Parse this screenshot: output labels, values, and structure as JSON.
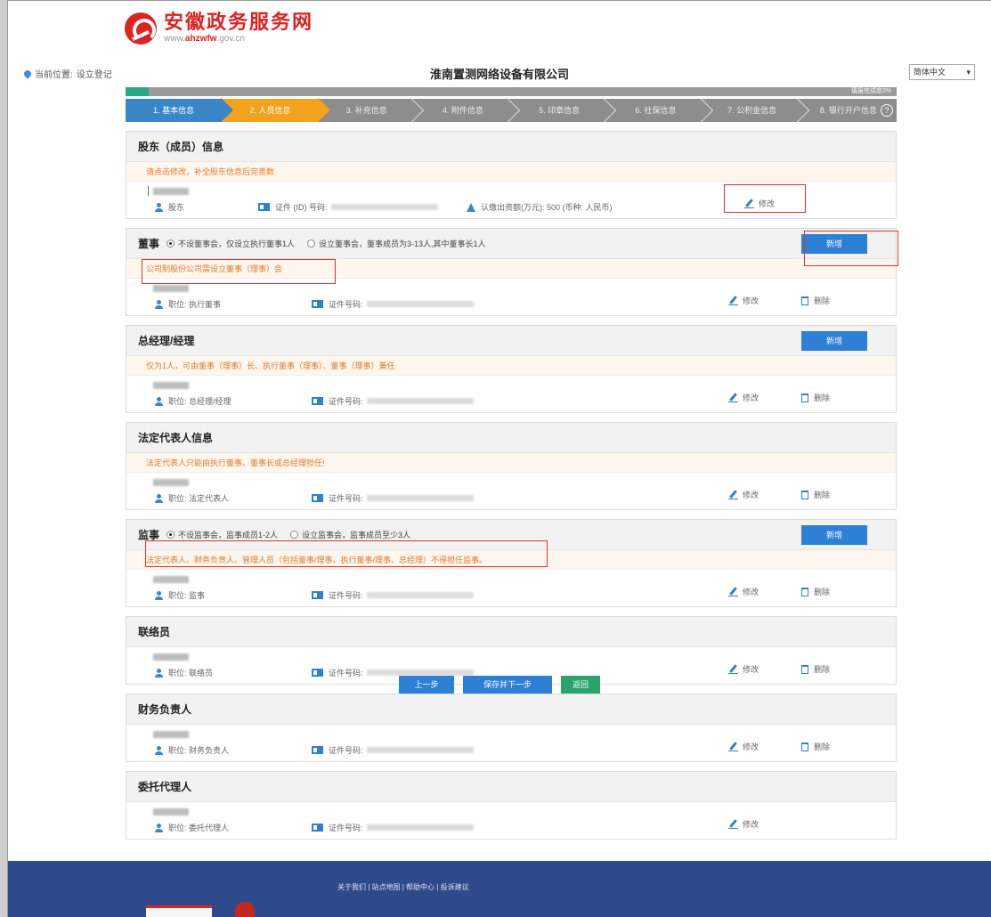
{
  "header": {
    "logo_name": "安徽政务服务网",
    "logo_url_prefix": "www.",
    "logo_url_domain": "ahzwfw",
    "logo_url_suffix": ".gov.cn"
  },
  "topbar": {
    "location_label": "当前位置:",
    "location_value": "设立登记",
    "company": "淮南置测网络设备有限公司",
    "language": "简体中文"
  },
  "progress": {
    "percent": 0.03,
    "label": "填报完成度3%"
  },
  "steps": [
    {
      "label": "1. 基本信息",
      "state": "done"
    },
    {
      "label": "2. 人员信息",
      "state": "active"
    },
    {
      "label": "3. 补充信息",
      "state": "todo"
    },
    {
      "label": "4. 附件信息",
      "state": "todo"
    },
    {
      "label": "5. 印章信息",
      "state": "todo"
    },
    {
      "label": "6. 社保信息",
      "state": "todo"
    },
    {
      "label": "7. 公积金信息",
      "state": "todo"
    },
    {
      "label": "8. 银行开户信息",
      "state": "todo"
    }
  ],
  "colors": {
    "brand": "#d22",
    "primary": "#2e7fd6",
    "step_active": "#f2a31b",
    "note_text": "#e27a2a",
    "save_green": "#2aa46b",
    "highlight": "#e0312f"
  },
  "shareholder": {
    "title": "股东（成员）信息",
    "note": "请点击修改，补全股东信息后完善数",
    "role": "股东",
    "id_label": "证件 (ID) 号码:",
    "capital_label": "认缴出资额(万元): 500 (币种: 人民币)",
    "edit": "修改"
  },
  "director": {
    "title": "董事",
    "option1": "不设董事会，仅设立执行董事1人",
    "option2": "设立董事会，董事成员为3-13人,其中董事长1人",
    "add": "新增",
    "note": "公司制股份公司需设立董事（理事）会",
    "role": "职位: 执行董事",
    "id_label": "证件号码:",
    "edit": "修改",
    "delete": "删除"
  },
  "manager": {
    "title": "总经理/经理",
    "add": "新增",
    "note": "仅为1人，可由董事（理事）长、执行董事（理事）、董事（理事）兼任",
    "role": "职位: 总经理/经理",
    "id_label": "证件号码:",
    "edit": "修改",
    "delete": "删除"
  },
  "legal_rep": {
    "title": "法定代表人信息",
    "note": "法定代表人只能由执行董事、董事长或总经理担任!",
    "role": "职位: 法定代表人",
    "id_label": "证件号码:",
    "edit": "修改",
    "delete": "删除"
  },
  "supervisor": {
    "title": "监事",
    "option1": "不设监事会，监事成员1-2人",
    "option2": "设立监事会，监事成员至少3人",
    "add": "新增",
    "note": "法定代表人、财务负责人、管理人员（包括董事/理事、执行董事/理事、总经理）不得担任监事。",
    "role": "职位: 监事",
    "id_label": "证件号码:",
    "edit": "修改",
    "delete": "删除"
  },
  "liaison": {
    "title": "联络员",
    "role": "职位: 联络员",
    "id_label": "证件号码:",
    "edit": "修改",
    "delete": "删除"
  },
  "finance": {
    "title": "财务负责人",
    "role": "职位: 财务负责人",
    "id_label": "证件号码:",
    "edit": "修改",
    "delete": "删除"
  },
  "agent": {
    "title": "委托代理人",
    "role": "职位: 委托代理人",
    "id_label": "证件号码:",
    "edit": "修改"
  },
  "buttons": {
    "prev": "上一步",
    "save_next": "保存并下一步",
    "back": "返回"
  },
  "footer": {
    "links": "关于我们 | 站点地图 | 帮助中心 | 投诉建议"
  }
}
